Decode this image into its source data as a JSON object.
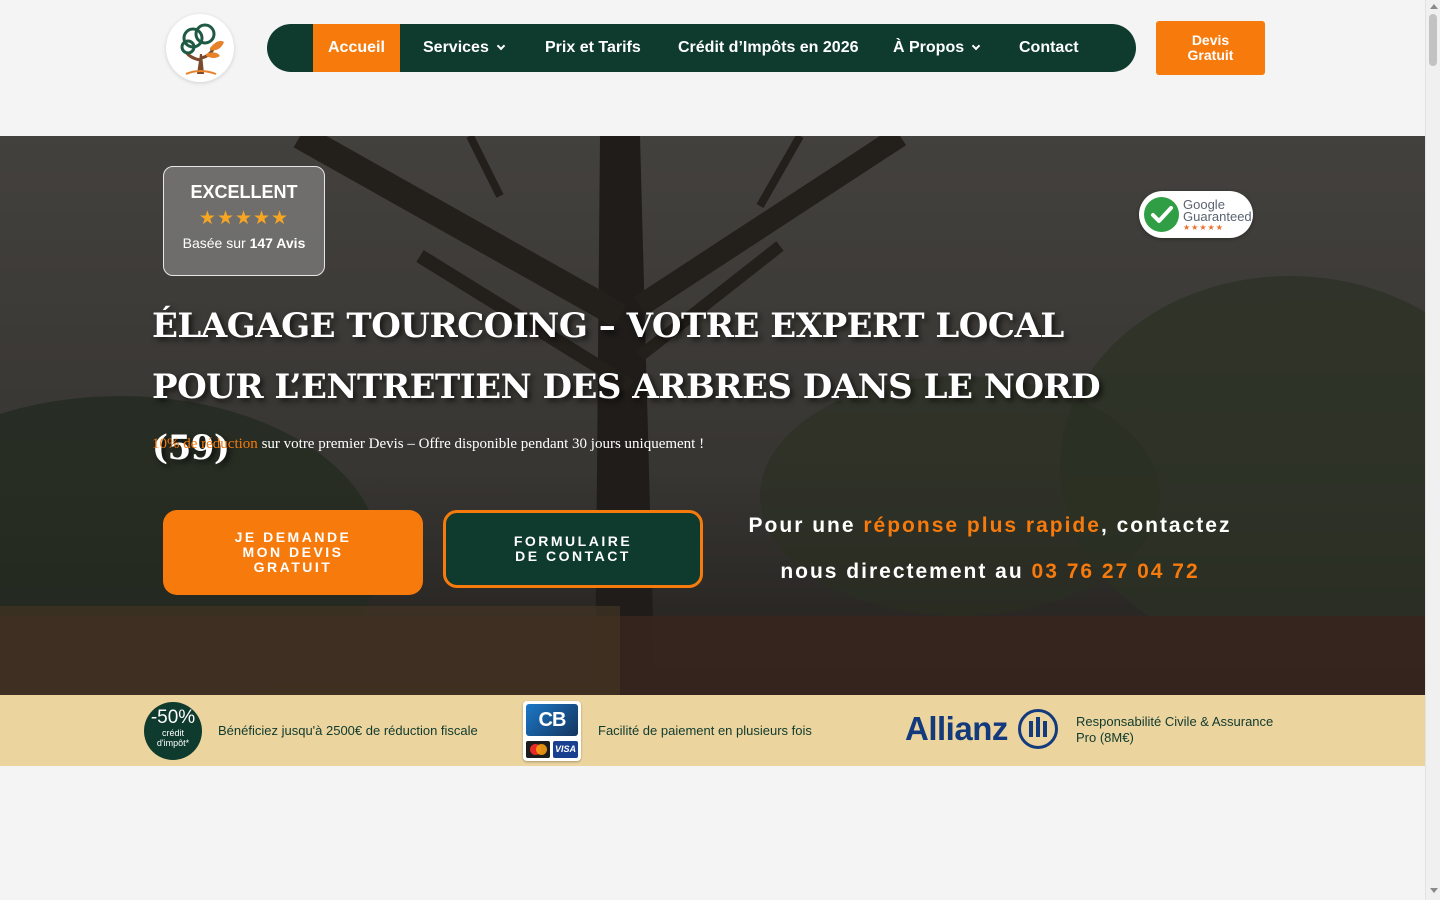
{
  "nav": {
    "items": [
      {
        "label": "Accueil",
        "active": true
      },
      {
        "label": "Services",
        "dropdown": true
      },
      {
        "label": "Prix et Tarifs"
      },
      {
        "label": "Crédit d’Impôts en 2026"
      },
      {
        "label": "À Propos",
        "dropdown": true
      },
      {
        "label": "Contact"
      }
    ],
    "cta_label": "Devis\nGratuit"
  },
  "hero": {
    "rating": {
      "title": "EXCELLENT",
      "stars": "★★★★★",
      "text_prefix": "Basée sur",
      "count": "147 Avis",
      "value": 5
    },
    "google_badge": {
      "line1": "Google",
      "line2": "Guaranteed",
      "stars": "★★★★★"
    },
    "headline": "ÉLAGAGE TOURCOING – VOTRE EXPERT LOCAL POUR L’ENTRETIEN DES ARBRES DANS LE NORD (59)",
    "promo_highlight": "10% de réduction",
    "promo_rest": " sur votre premier Devis – Offre disponible pendant 30 jours uniquement !",
    "primary_button": "JE DEMANDE\nMON DEVIS\nGRATUIT",
    "secondary_button": "FORMULAIRE\nDE CONTACT",
    "cta": {
      "part1": "Pour une ",
      "highlight": "réponse plus rapide",
      "part2": ", contactez nous directement au ",
      "phone": "03 76 27 04 72"
    }
  },
  "trust": {
    "credit_badge": {
      "pct": "-50%",
      "line1": "crédit",
      "line2": "d'impôt*"
    },
    "credit_text": "Bénéficiez jusqu'à 2500€ de réduction fiscale",
    "card_badge": {
      "cb": "CB",
      "visa": "VISA"
    },
    "payment_text": "Facilité de paiement en plusieurs fois",
    "insurer": "Allianz",
    "insurance_text": "Responsabilité Civile & Assurance Pro (8M€)"
  },
  "colors": {
    "accent": "#f77a0c",
    "dark_green": "#0f3a2e",
    "strip": "#ecd49e"
  }
}
